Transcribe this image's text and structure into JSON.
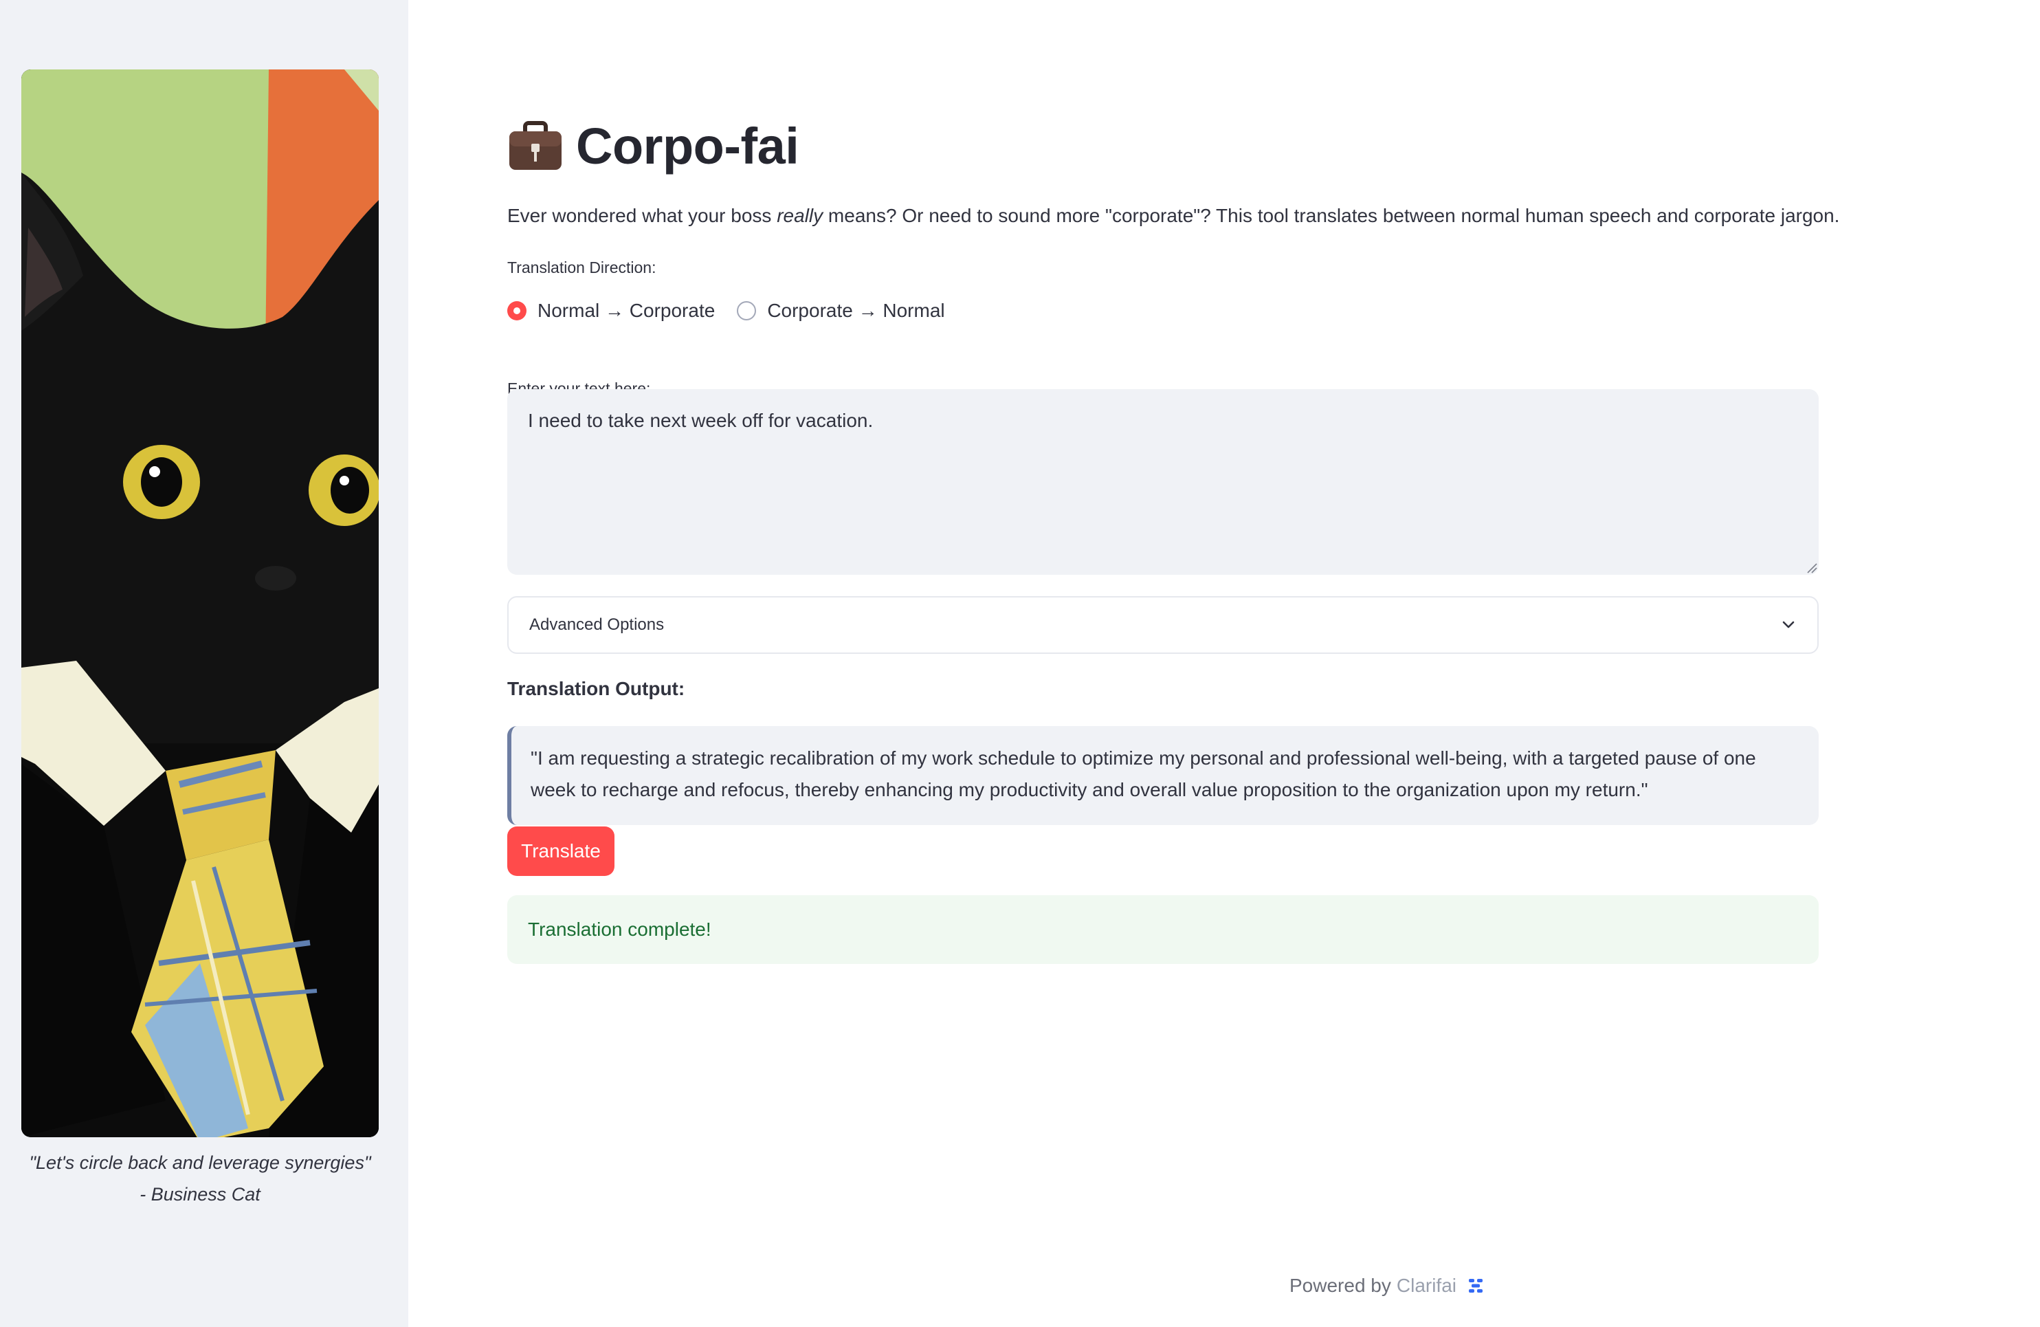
{
  "sidebar": {
    "image_icon": "business-cat-image",
    "caption_line1": "\"Let's circle back and leverage synergies\"",
    "caption_line2": "- Business Cat"
  },
  "header": {
    "icon": "briefcase-icon",
    "title": "Corpo-fai"
  },
  "intro": {
    "before": "Ever wondered what your boss ",
    "emphasis": "really",
    "after": " means? Or need to sound more \"corporate\"? This tool translates between normal human speech and corporate jargon."
  },
  "direction": {
    "label": "Translation Direction:",
    "options": [
      {
        "label": "Normal → Corporate",
        "selected": true
      },
      {
        "label": "Corporate → Normal",
        "selected": false
      }
    ]
  },
  "input": {
    "label": "Enter your text here:",
    "value": "I need to take next week off for vacation."
  },
  "advanced": {
    "label": "Advanced Options",
    "icon": "chevron-down-icon"
  },
  "output": {
    "heading": "Translation Output:",
    "text": "\"I am requesting a strategic recalibration of my work schedule to optimize my personal and professional well-being, with a targeted pause of one week to recharge and refocus, thereby enhancing my productivity and overall value proposition to the organization upon my return.\""
  },
  "actions": {
    "translate_label": "Translate"
  },
  "status": {
    "message": "Translation complete!"
  },
  "footer": {
    "powered_by": "Powered by",
    "link": "Clarifai",
    "icon": "clarifai-logo-icon"
  },
  "colors": {
    "accent": "#ff4b4b",
    "sidebar_bg": "#f0f2f6",
    "success_bg": "#f0f9f1",
    "success_text": "#1a6e33"
  }
}
